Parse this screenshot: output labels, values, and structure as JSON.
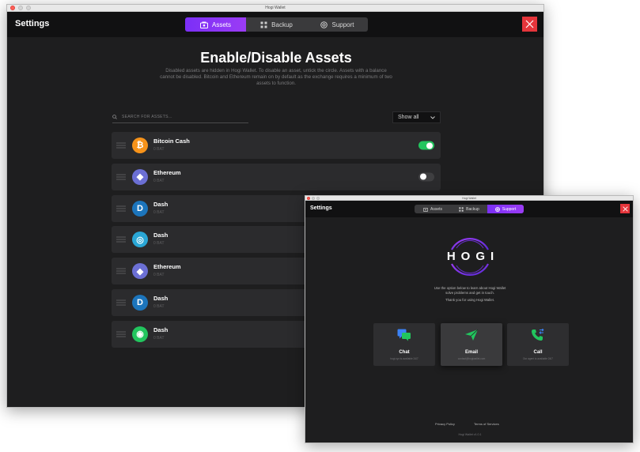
{
  "window1": {
    "title": "Hogi Wallet",
    "settings_label": "Settings",
    "tabs": [
      {
        "label": "Assets",
        "icon": "assets-icon",
        "active": true
      },
      {
        "label": "Backup",
        "icon": "backup-icon",
        "active": false
      },
      {
        "label": "Support",
        "icon": "support-icon",
        "active": false
      }
    ],
    "heading": "Enable/Disable Assets",
    "description": "Disabled assets are hidden in Hogi Wallet. To disable an asset, untick the circle. Assets with a balance cannot be disabled. Bitcoin and Ethereum remain on by default as the exchange requires a minimum of two assets to function.",
    "search": {
      "placeholder": "SEARCH FOR ASSETS..."
    },
    "filter": {
      "value": "Show all"
    },
    "assets": [
      {
        "name": "Bitcoin Cash",
        "balance": "0 BAT",
        "icon": "bitcoin-cash-icon",
        "glyph": "₿",
        "color": "#f7931a",
        "enabled": true
      },
      {
        "name": "Ethereum",
        "balance": "0 BAT",
        "icon": "ethereum-icon",
        "glyph": "◆",
        "color": "#6b6fd4",
        "enabled": false
      },
      {
        "name": "Dash",
        "balance": "0 BAT",
        "icon": "dash-icon",
        "glyph": "D",
        "color": "#1c75bc",
        "enabled": null
      },
      {
        "name": "Dash",
        "balance": "0 BAT",
        "icon": "dash-globe-icon",
        "glyph": "◎",
        "color": "#2aa7d6",
        "enabled": null
      },
      {
        "name": "Ethereum",
        "balance": "0 BAT",
        "icon": "ethereum-icon",
        "glyph": "◆",
        "color": "#6b6fd4",
        "enabled": null
      },
      {
        "name": "Dash",
        "balance": "0 BAT",
        "icon": "dash-icon",
        "glyph": "D",
        "color": "#1c75bc",
        "enabled": null
      },
      {
        "name": "Dash",
        "balance": "0 BAT",
        "icon": "dash-green-icon",
        "glyph": "◉",
        "color": "#22c55e",
        "enabled": null
      }
    ]
  },
  "window2": {
    "title": "Hogi Wallet",
    "settings_label": "Settings",
    "tabs": [
      {
        "label": "Assets",
        "icon": "assets-icon",
        "active": false
      },
      {
        "label": "Backup",
        "icon": "backup-icon",
        "active": false
      },
      {
        "label": "Support",
        "icon": "support-icon",
        "active": true
      }
    ],
    "logo_text": "HOGI",
    "support_text_1": "Use the option below to learn about Hogi Wallet solve problems and get in touch.",
    "support_text_2": "Thank you for using Hogi Wallet.",
    "cards": [
      {
        "title": "Chat",
        "sub": "hogi.xyz.is.available 24/7",
        "icon": "chat-icon",
        "color": "#3b82f6"
      },
      {
        "title": "Email",
        "sub": "contact@hogiwallet.com",
        "icon": "email-icon",
        "color": "#22c55e"
      },
      {
        "title": "Call",
        "sub": "Our agent is available 24/7",
        "icon": "call-icon",
        "color": "#22c55e"
      }
    ],
    "footer_links": [
      "Privacy Policy",
      "Terms of Services"
    ],
    "version": "Hogi Wallet v1.0.1"
  },
  "colors": {
    "accent": "#8b36f6",
    "close": "#e5353b",
    "toggle_on": "#22c55e",
    "background": "#1e1e1f"
  }
}
